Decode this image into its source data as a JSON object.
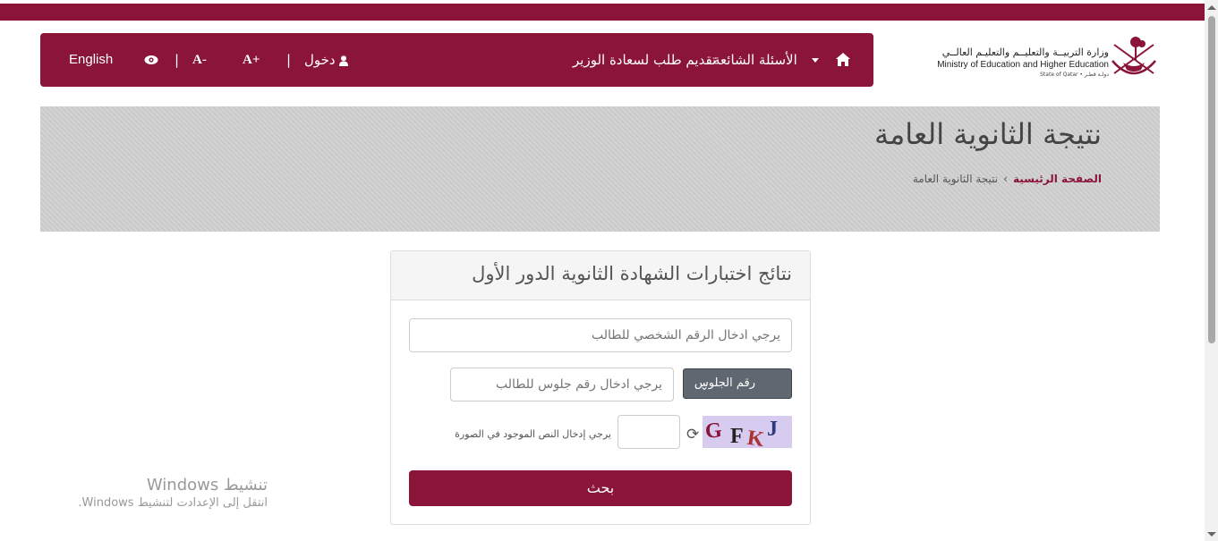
{
  "header": {
    "nav": {
      "language": "English",
      "font_decrease": "A-",
      "font_increase": "A+",
      "separator": "|",
      "login": "دخول",
      "minister_request": "تقديم طلب لسعادة الوزير",
      "faq": "الأسئلة الشائعة"
    },
    "logo": {
      "ministry_ar": "وزارة التربيــة والتعليــم والتعليـم العالــي",
      "ministry_en": "Ministry of Education and Higher Education",
      "state": "State of Qatar • دولـة قطـر"
    }
  },
  "banner": {
    "title": "نتيجة الثانوية العامة",
    "breadcrumb": {
      "home": "الصفحة الرئيسية",
      "separator": "›",
      "current": "نتيجة الثانوية العامة"
    }
  },
  "form": {
    "title": "نتائج اختبارات الشهادة الثانوية الدور الأول",
    "personal_id_placeholder": "يرجي ادخال الرقم الشخصي للطالب",
    "seat_type_label": "رقم الجلوس",
    "seat_placeholder": "يرجي ادخال رقم جلوس للطالب",
    "captcha_letters": [
      "G",
      "F",
      "K",
      "J"
    ],
    "captcha_hint": "يرجي إدخال النص الموجود في الصورة",
    "search_label": "بحث"
  },
  "watermark": {
    "line1": "تنشيط Windows",
    "line2": "انتقل إلى الإعدادت لتنشيط Windows."
  },
  "colors": {
    "brand": "#8a1538",
    "banner": "#cfcfcf",
    "seat_button": "#5f6770",
    "captcha_bg": "#d8cbf0"
  }
}
